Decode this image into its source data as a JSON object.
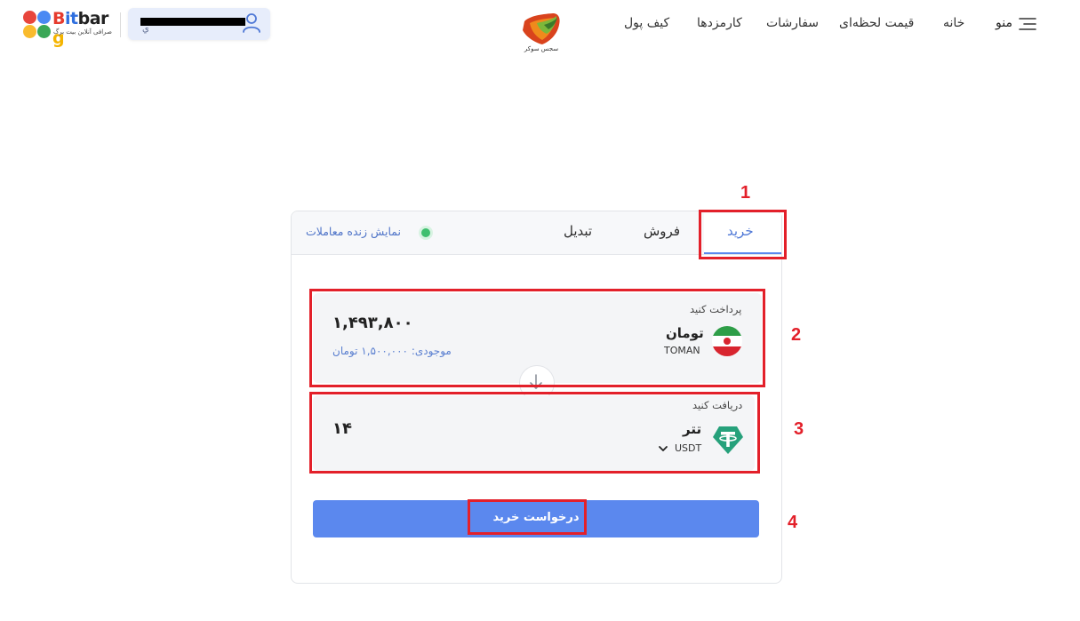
{
  "brand": {
    "name_parts": [
      {
        "text": "B",
        "color": "#e63b2e"
      },
      {
        "text": "it",
        "color": "#2f6fdf"
      },
      {
        "text": "bar",
        "color": "#222222"
      },
      {
        "text": "g",
        "color": "#f4b400"
      }
    ],
    "tagline": "صرافی آنلاین بیت برگ",
    "dot_colors": [
      "#e8453c",
      "#4a89f3",
      "#f9bb2d",
      "#3aa757"
    ]
  },
  "user": {
    "hint": "ي",
    "icon": "user-icon"
  },
  "site": {
    "logo_text": "سجس سوکر"
  },
  "nav": {
    "menu_label": "منو",
    "items": [
      "خانه",
      "قیمت لحظه‌ای",
      "سفارشات",
      "کارمزدها",
      "کیف پول"
    ]
  },
  "tabs": {
    "buy": "خرید",
    "sell": "فروش",
    "convert": "تبدیل",
    "live_label": "نمایش زنده معاملات"
  },
  "pay": {
    "label": "پرداخت کنید",
    "currency_name": "تومان",
    "currency_code": "TOMAN",
    "amount": "۱,۴۹۳,۸۰۰",
    "balance": "موجودی: ۱,۵۰۰,۰۰۰ تومان"
  },
  "receive": {
    "label": "دریافت کنید",
    "currency_name": "تتر",
    "currency_code": "USDT",
    "amount": "۱۴"
  },
  "submit_label": "درخواست خرید",
  "annotations": [
    "1",
    "2",
    "3",
    "4"
  ],
  "colors": {
    "accent": "#5b88ee",
    "annotation_red": "#e3202a",
    "live_green": "#3fbf6f",
    "tether_green": "#26a17b"
  }
}
